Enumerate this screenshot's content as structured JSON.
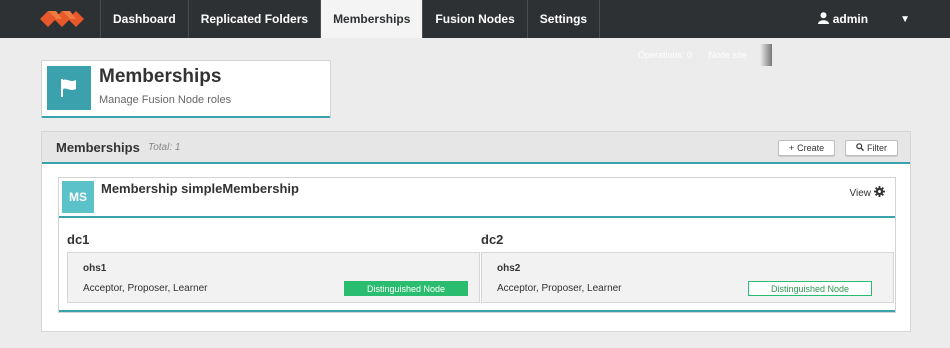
{
  "nav": {
    "items": [
      {
        "label": "Dashboard"
      },
      {
        "label": "Replicated Folders"
      },
      {
        "label": "Memberships"
      },
      {
        "label": "Fusion Nodes"
      },
      {
        "label": "Settings"
      }
    ],
    "active": "Memberships",
    "user": "admin",
    "icons": {
      "logo": "logo-icon",
      "user": "user-icon",
      "caret": "caret-down-icon"
    }
  },
  "stats": {
    "operations": "Operations: 0",
    "node_site": "Node site"
  },
  "page": {
    "title": "Memberships",
    "subtitle": "Manage Fusion Node roles",
    "icon": "flag-icon"
  },
  "panel": {
    "title": "Memberships",
    "total": "Total: 1",
    "create_label": "Create",
    "create_icon": "+",
    "filter_label": "Filter",
    "filter_icon": "search-icon"
  },
  "membership": {
    "badge": "MS",
    "title": "Membership simpleMembership",
    "view_label": "View",
    "view_icon": "gear-icon",
    "zones": [
      {
        "name": "dc1",
        "node": "ohs1",
        "roles": "Acceptor, Proposer, Learner",
        "badge": "Distinguished Node",
        "badge_style": "solid"
      },
      {
        "name": "dc2",
        "node": "ohs2",
        "roles": "Acceptor, Proposer, Learner",
        "badge": "Distinguished Node",
        "badge_style": "outline"
      }
    ]
  },
  "colors": {
    "nav_bg": "#2e3133",
    "accent": "#3aa1ad",
    "logo": "#e8582a",
    "badge_green": "#2bbd6f"
  }
}
